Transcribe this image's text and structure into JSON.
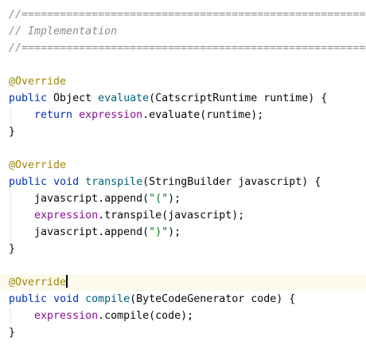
{
  "editor": {
    "lines": [
      [
        {
          "t": "comment",
          "v": "//============================================================"
        }
      ],
      [
        {
          "t": "comment",
          "v": "// Implementation"
        }
      ],
      [
        {
          "t": "comment",
          "v": "//============================================================"
        }
      ],
      [],
      [
        {
          "t": "annot",
          "v": "@Override"
        }
      ],
      [
        {
          "t": "kw",
          "v": "public"
        },
        {
          "t": "plain",
          "v": " Object "
        },
        {
          "t": "method",
          "v": "evaluate"
        },
        {
          "t": "plain",
          "v": "(CatscriptRuntime runtime) {"
        }
      ],
      [
        {
          "t": "plain",
          "v": "    "
        },
        {
          "t": "kw",
          "v": "return"
        },
        {
          "t": "plain",
          "v": " "
        },
        {
          "t": "field",
          "v": "expression"
        },
        {
          "t": "plain",
          "v": ".evaluate(runtime);"
        }
      ],
      [
        {
          "t": "plain",
          "v": "}"
        }
      ],
      [],
      [
        {
          "t": "annot",
          "v": "@Override"
        }
      ],
      [
        {
          "t": "kw",
          "v": "public"
        },
        {
          "t": "plain",
          "v": " "
        },
        {
          "t": "kw",
          "v": "void"
        },
        {
          "t": "plain",
          "v": " "
        },
        {
          "t": "method",
          "v": "transpile"
        },
        {
          "t": "plain",
          "v": "(StringBuilder javascript) {"
        }
      ],
      [
        {
          "t": "plain",
          "v": "    javascript.append("
        },
        {
          "t": "str",
          "v": "\"(\""
        },
        {
          "t": "plain",
          "v": ");"
        }
      ],
      [
        {
          "t": "plain",
          "v": "    "
        },
        {
          "t": "field",
          "v": "expression"
        },
        {
          "t": "plain",
          "v": ".transpile(javascript);"
        }
      ],
      [
        {
          "t": "plain",
          "v": "    javascript.append("
        },
        {
          "t": "str",
          "v": "\")\""
        },
        {
          "t": "plain",
          "v": ");"
        }
      ],
      [
        {
          "t": "plain",
          "v": "}"
        }
      ],
      [],
      [
        {
          "t": "annot",
          "v": "@Override"
        },
        {
          "t": "caret",
          "v": ""
        }
      ],
      [
        {
          "t": "kw",
          "v": "public"
        },
        {
          "t": "plain",
          "v": " "
        },
        {
          "t": "kw",
          "v": "void"
        },
        {
          "t": "plain",
          "v": " "
        },
        {
          "t": "method",
          "v": "compile"
        },
        {
          "t": "plain",
          "v": "(ByteCodeGenerator code) {"
        }
      ],
      [
        {
          "t": "plain",
          "v": "    "
        },
        {
          "t": "field",
          "v": "expression"
        },
        {
          "t": "plain",
          "v": ".compile(code);"
        }
      ],
      [
        {
          "t": "plain",
          "v": "}"
        }
      ]
    ],
    "active_line": 16,
    "colors": {
      "comment": "#8c8c8c",
      "annotation": "#9e880d",
      "keyword": "#0033b3",
      "field": "#871094",
      "method": "#00627a",
      "string": "#067d17",
      "text": "#080808",
      "active_line_bg": "#fcfaed"
    }
  }
}
